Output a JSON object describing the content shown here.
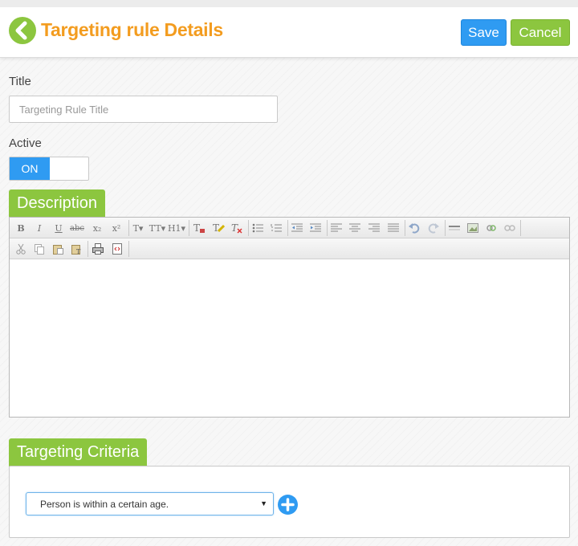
{
  "header": {
    "title": "Targeting rule Details",
    "save_label": "Save",
    "cancel_label": "Cancel"
  },
  "form": {
    "title_label": "Title",
    "title_placeholder": "Targeting Rule Title",
    "title_value": "",
    "active_label": "Active",
    "active_toggle": "ON"
  },
  "description": {
    "tab_label": "Description",
    "toolbar_row1": [
      "bold",
      "italic",
      "underline",
      "strikethrough",
      "subscript",
      "superscript",
      "font",
      "font-size",
      "format",
      "text-color",
      "background-color",
      "remove-format",
      "bulleted-list",
      "numbered-list",
      "outdent",
      "indent",
      "align-left",
      "align-center",
      "align-right",
      "justify",
      "undo",
      "redo",
      "horizontal-rule",
      "image",
      "link",
      "unlink"
    ],
    "toolbar_row2": [
      "cut",
      "copy",
      "paste",
      "paste-text",
      "print",
      "source"
    ],
    "glyphs": {
      "bold": "B",
      "italic": "I",
      "underline": "U",
      "strike": "abc",
      "sub": "x₂",
      "sup": "x²",
      "font": "T▾",
      "size": "TT▾",
      "format": "H1▾"
    }
  },
  "criteria": {
    "tab_label": "Targeting Criteria",
    "select_value": "Person is within a certain age.",
    "select_arrow": "▼"
  },
  "colors": {
    "accent_green": "#8cc63f",
    "accent_orange": "#f39c1f",
    "accent_blue": "#2f9bf2"
  }
}
